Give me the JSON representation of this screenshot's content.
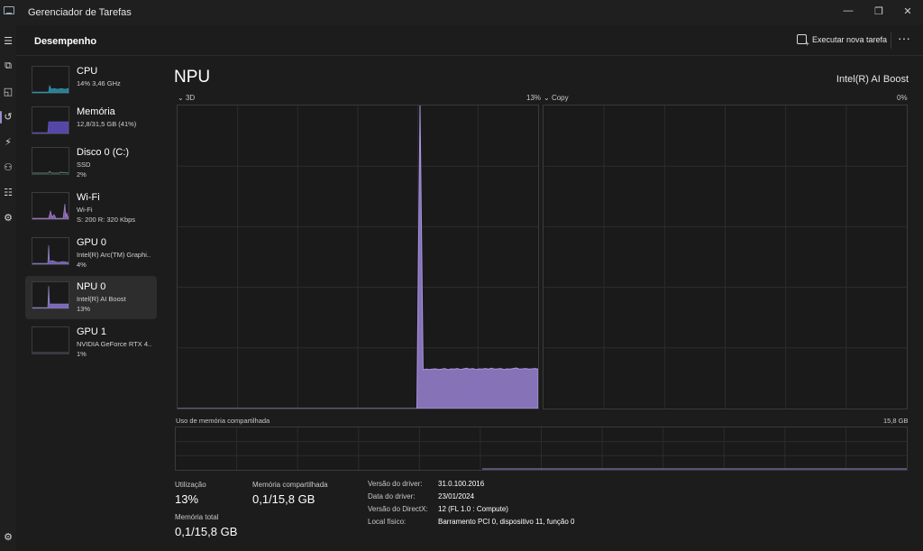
{
  "window": {
    "title": "Gerenciador de Tarefas",
    "minimize": "—",
    "maximize": "❐",
    "close": "✕"
  },
  "header": {
    "title": "Desempenho",
    "run_task": "Executar nova tarefa",
    "more": "···"
  },
  "rail": {
    "icons": [
      "hamburger-icon",
      "processes-icon",
      "performance-icon",
      "history-icon",
      "startup-icon",
      "users-icon",
      "details-icon",
      "services-icon",
      "settings-icon"
    ],
    "glyphs": [
      "☰",
      "⧉",
      "◱",
      "↺",
      "⚡",
      "⚇",
      "☷",
      "⚙",
      "⚙"
    ]
  },
  "sidebar": {
    "items": [
      {
        "name": "CPU",
        "sub": "14% 3,46 GHz",
        "sub2": "",
        "color": "#2fa6bf"
      },
      {
        "name": "Memória",
        "sub": "12,8/31,5 GB (41%)",
        "sub2": "",
        "color": "#6a5cc8"
      },
      {
        "name": "Disco 0 (C:)",
        "sub": "SSD",
        "sub2": "2%",
        "color": "#5fb38b"
      },
      {
        "name": "Wi-Fi",
        "sub": "Wi-Fi",
        "sub2": "S: 200  R: 320 Kbps",
        "color": "#b48ad6"
      },
      {
        "name": "GPU 0",
        "sub": "Intel(R) Arc(TM) Graphi..",
        "sub2": "4%",
        "color": "#9a88d0"
      },
      {
        "name": "NPU 0",
        "sub": "Intel(R) AI Boost",
        "sub2": "13%",
        "color": "#9a88d0"
      },
      {
        "name": "GPU 1",
        "sub": "NVIDIA GeForce RTX 4..",
        "sub2": "1%",
        "color": "#9a88d0"
      }
    ]
  },
  "main": {
    "title": "NPU",
    "model": "Intel(R) AI Boost",
    "graph_left": {
      "label": "3D",
      "value": "13%"
    },
    "graph_right": {
      "label": "Copy",
      "value": "0%"
    },
    "mem_label": "Uso de memória compartilhada",
    "mem_max": "15,8 GB",
    "accent": "#8f79c4"
  },
  "chart_data": {
    "type": "area",
    "title": "3D",
    "ylim": [
      0,
      100
    ],
    "series": [
      {
        "values": [
          0,
          0,
          0,
          0,
          0,
          0,
          0,
          0,
          0,
          0,
          0,
          0,
          0,
          0,
          0,
          0,
          0,
          0,
          0,
          0,
          0,
          0,
          0,
          0,
          0,
          0,
          0,
          0,
          0,
          0,
          0,
          0,
          0,
          0,
          0,
          0,
          0,
          0,
          0,
          0,
          0,
          0,
          0,
          0,
          0,
          0,
          0,
          0,
          0,
          0,
          0,
          0,
          0,
          0,
          0,
          0,
          0,
          0,
          0,
          0,
          0,
          0,
          0,
          0,
          0,
          0,
          0,
          0,
          0,
          0,
          0,
          0,
          0,
          0,
          0,
          0,
          0,
          0,
          100,
          12.8,
          13.0,
          12.9,
          13.0,
          13.1,
          12.9,
          13.0,
          13.2,
          12.8,
          13.1,
          13.0,
          13.2,
          12.9,
          13.1,
          13.3,
          13.0,
          13.2,
          12.9,
          13.1,
          13.0,
          13.2,
          13.0,
          13.3,
          13.0,
          13.1,
          13.2,
          12.9,
          13.1,
          13.0,
          13.2,
          13.4,
          13.0,
          13.1,
          13.2,
          13.0,
          13.1,
          13.2,
          13.0
        ]
      }
    ]
  },
  "stats": {
    "util_label": "Utilização",
    "util_value": "13%",
    "shared_label": "Memória compartilhada",
    "shared_value": "0,1/15,8 GB",
    "total_label": "Memória total",
    "total_value": "0,1/15,8 GB"
  },
  "info": [
    {
      "key": "Versão do driver:",
      "value": "31.0.100.2016"
    },
    {
      "key": "Data do driver:",
      "value": "23/01/2024"
    },
    {
      "key": "Versão do DirectX:",
      "value": "12 (FL 1.0 : Compute)"
    },
    {
      "key": "Local físico:",
      "value": "Barramento PCI 0, dispositivo 11, função 0"
    }
  ]
}
